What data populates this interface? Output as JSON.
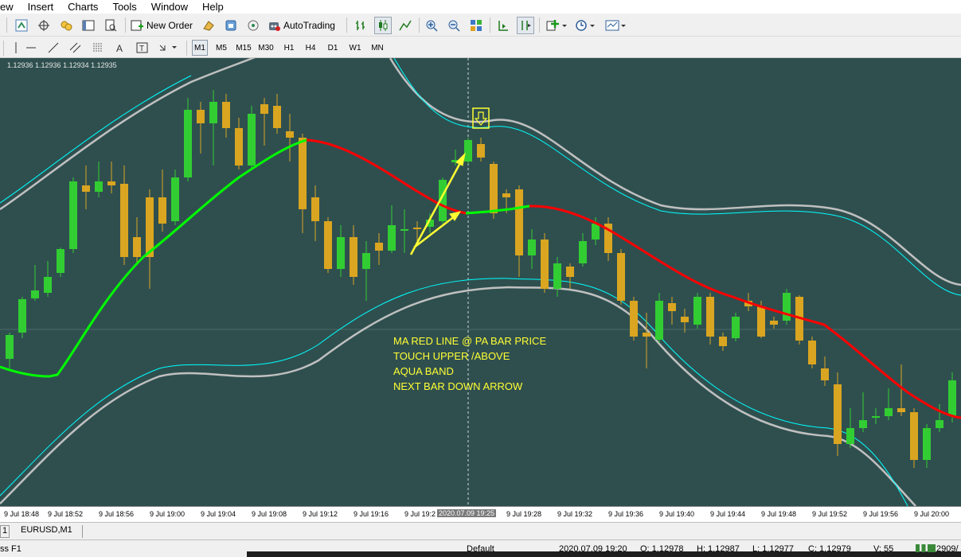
{
  "menu": [
    "ew",
    "Insert",
    "Charts",
    "Tools",
    "Window",
    "Help"
  ],
  "toolbar": {
    "new_order": "New Order",
    "auto_trading": "AutoTrading"
  },
  "timeframes": [
    "M1",
    "M5",
    "M15",
    "M30",
    "H1",
    "H4",
    "D1",
    "W1",
    "MN"
  ],
  "active_timeframe": "M1",
  "chart": {
    "quote": "1.12936 1.12936 1.12934 1.12935",
    "background": "#2f4f4f",
    "bull_color": "#32cd32",
    "bear_color": "#daa520",
    "ma_up_color": "#00ff00",
    "ma_down_color": "#ff0000",
    "inner_band_color": "#00ffff",
    "outer_band_color": "#c0c0c0",
    "annotation_color": "#ffff33",
    "annotation": [
      "MA RED LINE @ PA BAR PRICE",
      "TOUCH UPPER /ABOVE",
      "AQUA BAND",
      "NEXT BAR DOWN ARROW"
    ],
    "signal_icon": "down-arrow-icon"
  },
  "time_axis": {
    "labels": [
      "9 Jul 18:48",
      "9 Jul 18:52",
      "9 Jul 18:56",
      "9 Jul 19:00",
      "9 Jul 19:04",
      "9 Jul 19:08",
      "9 Jul 19:12",
      "9 Jul 19:16",
      "9 Jul 19:2",
      "9 Jul 19:28",
      "9 Jul 19:32",
      "9 Jul 19:36",
      "9 Jul 19:40",
      "9 Jul 19:44",
      "9 Jul 19:48",
      "9 Jul 19:52",
      "9 Jul 19:56",
      "9 Jul 20:00"
    ],
    "crosshair_label": "2020.07.09 19:25"
  },
  "tabs": [
    "1",
    "EURUSD,M1"
  ],
  "status": {
    "help": "ss F1",
    "profile": "Default",
    "datetime": "2020.07.09 19:20",
    "open": "O: 1.12978",
    "high": "H: 1.12987",
    "low": "L: 1.12977",
    "close": "C: 1.12979",
    "volume": "V: 55",
    "traffic": "2909/"
  }
}
